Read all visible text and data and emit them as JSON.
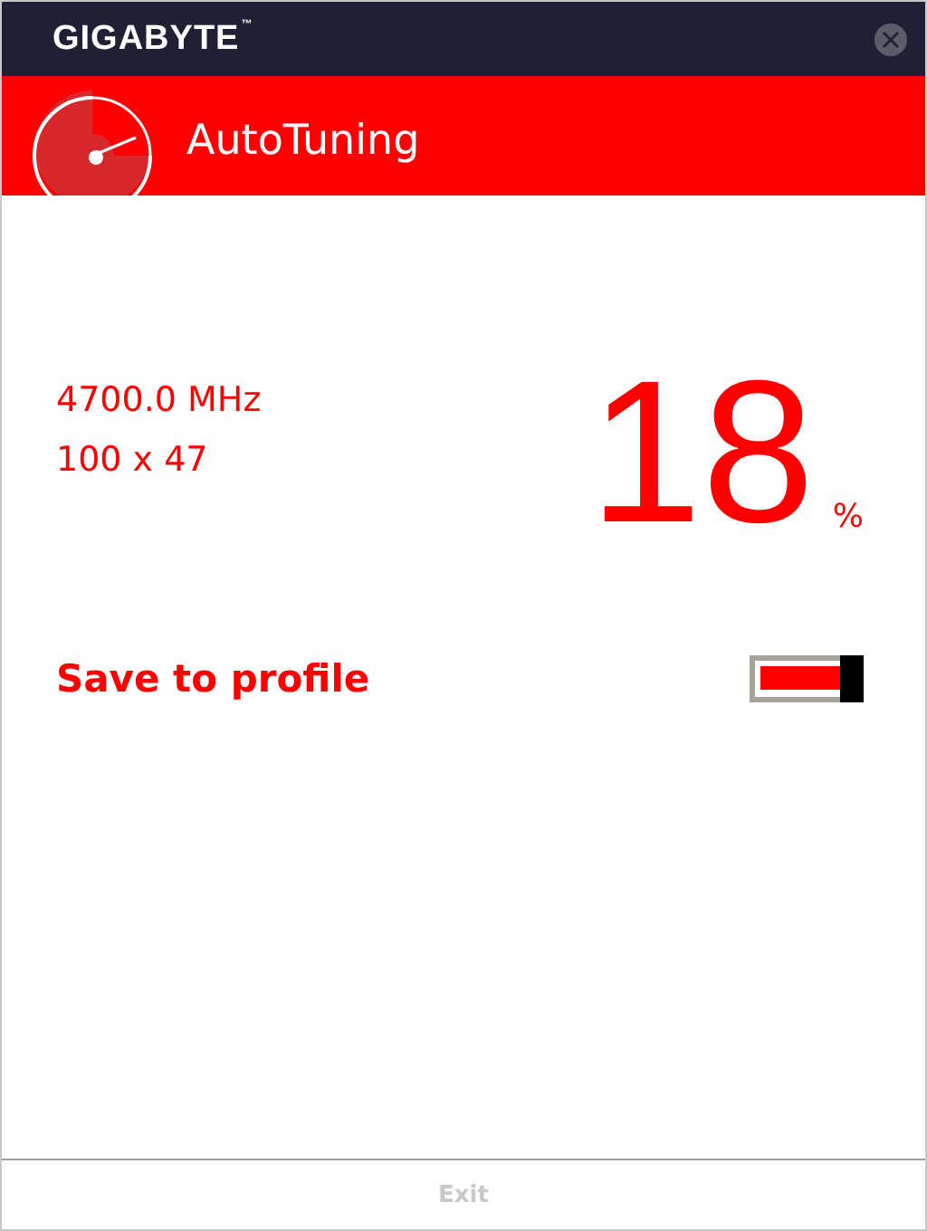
{
  "window": {
    "brand": "GIGABYTE",
    "trademark": "™"
  },
  "header": {
    "title": "AutoTuning"
  },
  "readings": {
    "frequency": "4700.0 MHz",
    "multiplier": "100 x 47",
    "progress": "18",
    "unit": "%"
  },
  "save_to_profile": {
    "label": "Save to profile",
    "on": true
  },
  "footer": {
    "button": {
      "label": "Exit",
      "disabled": true
    }
  }
}
